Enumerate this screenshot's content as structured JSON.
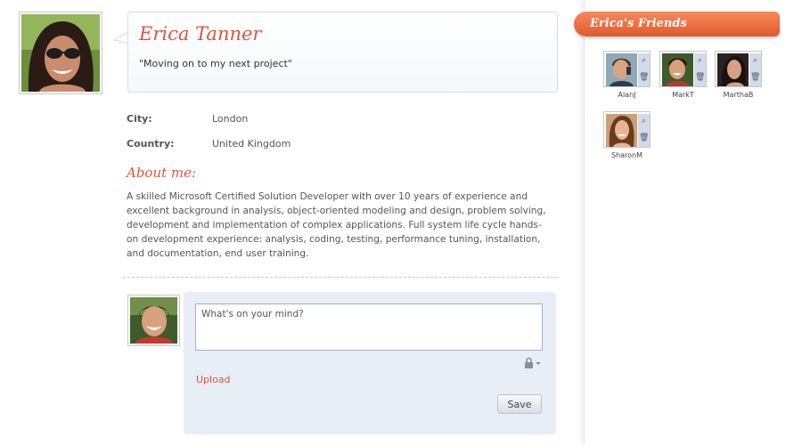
{
  "profile": {
    "name": "Erica Tanner",
    "status": "\"Moving on to my next project\"",
    "city_label": "City:",
    "city_value": "London",
    "country_label": "Country:",
    "country_value": "United Kingdom",
    "about_title": "About me:",
    "about_text": "A skilled Microsoft Certified Solution Developer with over 10 years of experience and excellent background in analysis, object-oriented modeling and design, problem solving, development and implementation of complex applications. Full system life cycle hands-on development experience: analysis, coding, testing, performance tuning, installation, and documentation, end user training."
  },
  "composer": {
    "placeholder": "What's on your mind?",
    "upload_label": "Upload",
    "save_label": "Save",
    "privacy_icon": "lock-dropdown-icon"
  },
  "friends": {
    "title": "Erica's Friends",
    "items": [
      {
        "name": "AlanJ"
      },
      {
        "name": "MarkT"
      },
      {
        "name": "MarthaB"
      },
      {
        "name": "SharonM"
      }
    ],
    "tool_icons": [
      "zoom-icon",
      "delete-icon"
    ]
  },
  "colors": {
    "accent": "#d9573c",
    "header_gradient_top": "#f48a5c",
    "header_gradient_bottom": "#e25a2d",
    "composer_bg": "#e8eef6"
  }
}
